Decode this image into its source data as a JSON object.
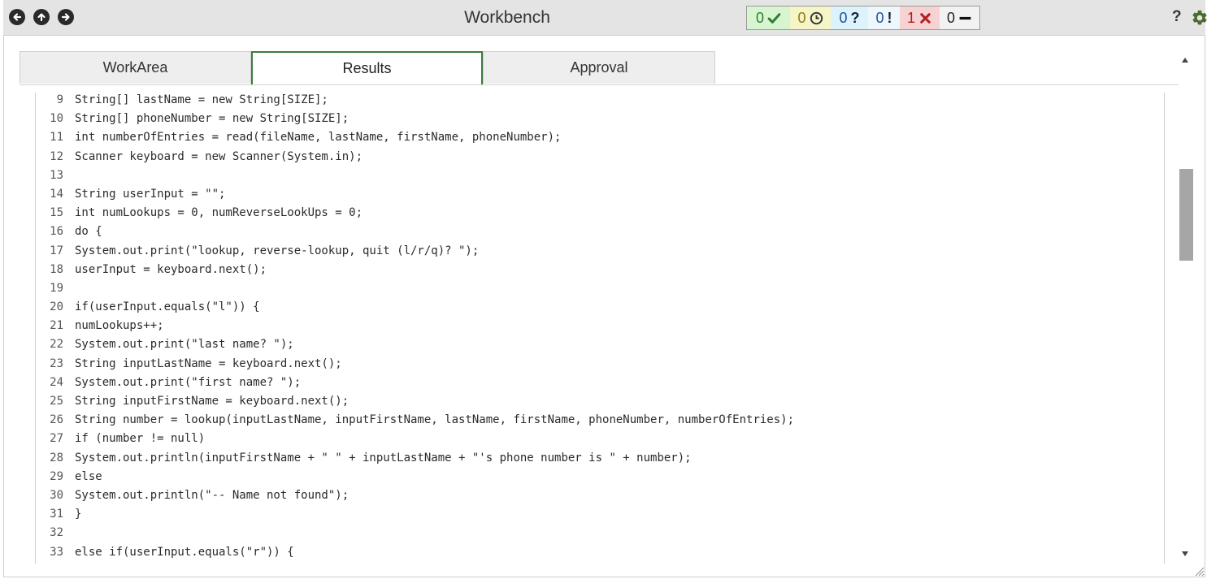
{
  "window": {
    "title": "Workbench"
  },
  "nav": {
    "back_icon": "arrow-left-circle-icon",
    "up_icon": "arrow-up-circle-icon",
    "forward_icon": "arrow-right-circle-icon"
  },
  "status": {
    "passed": "0",
    "pending": "0",
    "unknown": "0",
    "alerts": "0",
    "failed": "1",
    "none": "0",
    "colors": {
      "passed_bg": "#d6f5d0",
      "pending_bg": "#f6f5c8",
      "unknown_bg": "#dcf3fb",
      "alerts_bg": "#eef7fb",
      "failed_bg": "#f7d2d2",
      "none_bg": "#f2f2f2"
    }
  },
  "help": {
    "label": "?"
  },
  "tabs": [
    {
      "label": "WorkArea",
      "active": false
    },
    {
      "label": "Results",
      "active": true
    },
    {
      "label": "Approval",
      "active": false
    }
  ],
  "code": {
    "lines": [
      {
        "n": "9",
        "text": "String[] lastName = new String[SIZE];"
      },
      {
        "n": "10",
        "text": "String[] phoneNumber = new String[SIZE];"
      },
      {
        "n": "11",
        "text": "int numberOfEntries = read(fileName, lastName, firstName, phoneNumber);"
      },
      {
        "n": "12",
        "text": "Scanner keyboard = new Scanner(System.in);"
      },
      {
        "n": "13",
        "text": ""
      },
      {
        "n": "14",
        "text": "String userInput = \"\";"
      },
      {
        "n": "15",
        "text": "int numLookups = 0, numReverseLookUps = 0;"
      },
      {
        "n": "16",
        "text": "do {"
      },
      {
        "n": "17",
        "text": "System.out.print(\"lookup, reverse-lookup, quit (l/r/q)? \");"
      },
      {
        "n": "18",
        "text": "userInput = keyboard.next();"
      },
      {
        "n": "19",
        "text": ""
      },
      {
        "n": "20",
        "text": "if(userInput.equals(\"l\")) {"
      },
      {
        "n": "21",
        "text": "numLookups++;"
      },
      {
        "n": "22",
        "text": "System.out.print(\"last name? \");"
      },
      {
        "n": "23",
        "text": "String inputLastName = keyboard.next();"
      },
      {
        "n": "24",
        "text": "System.out.print(\"first name? \");"
      },
      {
        "n": "25",
        "text": "String inputFirstName = keyboard.next();"
      },
      {
        "n": "26",
        "text": "String number = lookup(inputLastName, inputFirstName, lastName, firstName, phoneNumber, numberOfEntries);"
      },
      {
        "n": "27",
        "text": "if (number != null)"
      },
      {
        "n": "28",
        "text": "System.out.println(inputFirstName + \" \" + inputLastName + \"'s phone number is \" + number);"
      },
      {
        "n": "29",
        "text": "else"
      },
      {
        "n": "30",
        "text": "System.out.println(\"-- Name not found\");"
      },
      {
        "n": "31",
        "text": "}"
      },
      {
        "n": "32",
        "text": ""
      },
      {
        "n": "33",
        "text": "else if(userInput.equals(\"r\")) {"
      }
    ]
  }
}
